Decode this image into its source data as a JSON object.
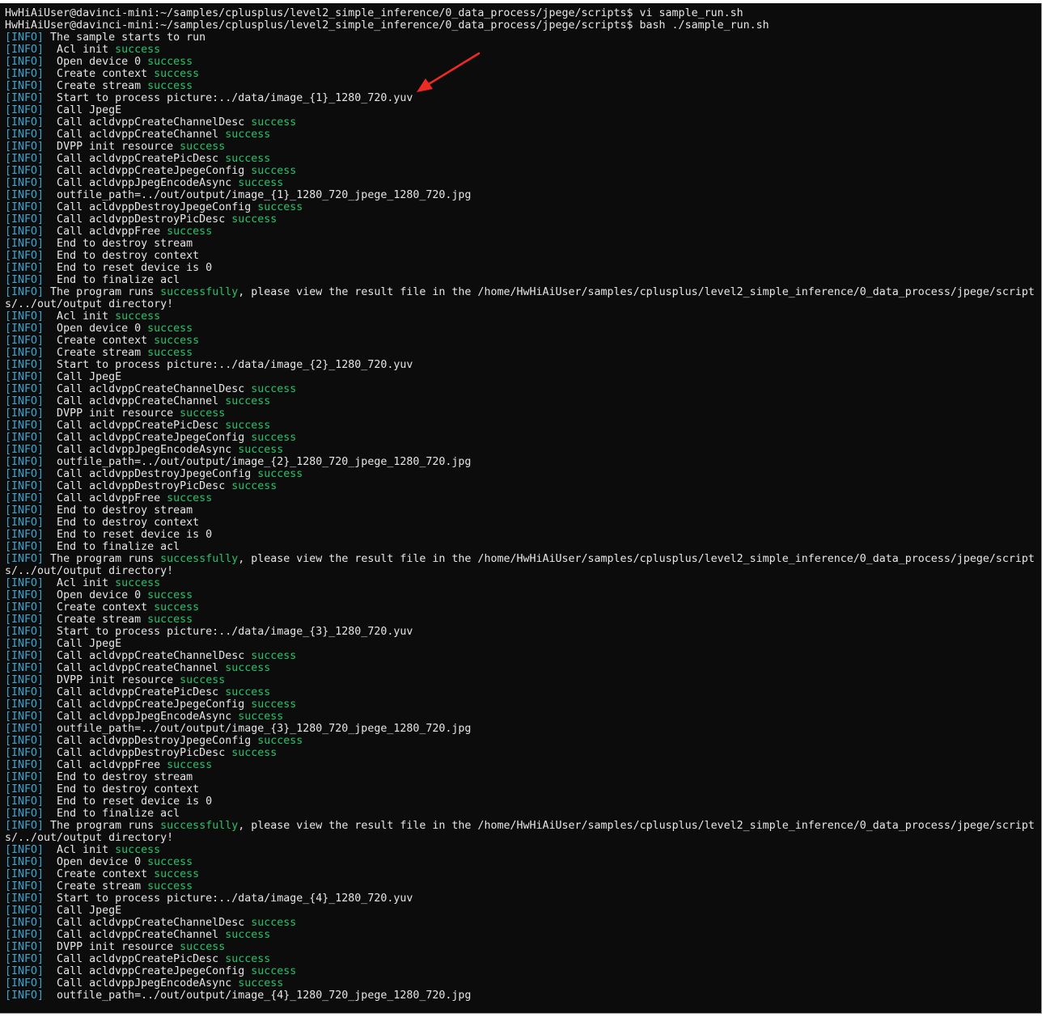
{
  "colors": {
    "background": "#0c0c0c",
    "text": "#e6e6e6",
    "info_tag": "#3aa7d0",
    "success": "#23c46b",
    "annotation_arrow": "#ee2a24"
  },
  "terminal": {
    "lines": [
      {
        "text": "HwHiAiUser@davinci-mini:~/samples/cplusplus/level2_simple_inference/0_data_process/jpege/scripts$ vi sample_run.sh"
      },
      {
        "text": "HwHiAiUser@davinci-mini:~/samples/cplusplus/level2_simple_inference/0_data_process/jpege/scripts$ bash ./sample_run.sh"
      },
      {
        "tag": "[INFO]",
        "text": " The sample starts to run"
      },
      {
        "tag": "[INFO]",
        "text": "  Acl init ",
        "ok": "success"
      },
      {
        "tag": "[INFO]",
        "text": "  Open device 0 ",
        "ok": "success"
      },
      {
        "tag": "[INFO]",
        "text": "  Create context ",
        "ok": "success"
      },
      {
        "tag": "[INFO]",
        "text": "  Create stream ",
        "ok": "success"
      },
      {
        "tag": "[INFO]",
        "text": "  Start to process picture:../data/image_{1}_1280_720.yuv"
      },
      {
        "tag": "[INFO]",
        "text": "  Call JpegE"
      },
      {
        "tag": "[INFO]",
        "text": "  Call acldvppCreateChannelDesc ",
        "ok": "success"
      },
      {
        "tag": "[INFO]",
        "text": "  Call acldvppCreateChannel ",
        "ok": "success"
      },
      {
        "tag": "[INFO]",
        "text": "  DVPP init resource ",
        "ok": "success"
      },
      {
        "tag": "[INFO]",
        "text": "  Call acldvppCreatePicDesc ",
        "ok": "success"
      },
      {
        "tag": "[INFO]",
        "text": "  Call acldvppCreateJpegeConfig ",
        "ok": "success"
      },
      {
        "tag": "[INFO]",
        "text": "  Call acldvppJpegEncodeAsync ",
        "ok": "success"
      },
      {
        "tag": "[INFO]",
        "text": "  outfile_path=../out/output/image_{1}_1280_720_jpege_1280_720.jpg"
      },
      {
        "tag": "[INFO]",
        "text": "  Call acldvppDestroyJpegeConfig ",
        "ok": "success"
      },
      {
        "tag": "[INFO]",
        "text": "  Call acldvppDestroyPicDesc ",
        "ok": "success"
      },
      {
        "tag": "[INFO]",
        "text": "  Call acldvppFree ",
        "ok": "success"
      },
      {
        "tag": "[INFO]",
        "text": "  End to destroy stream"
      },
      {
        "tag": "[INFO]",
        "text": "  End to destroy context"
      },
      {
        "tag": "[INFO]",
        "text": "  End to reset device is 0"
      },
      {
        "tag": "[INFO]",
        "text": "  End to finalize acl"
      },
      {
        "tag": "[INFO]",
        "text": " The program runs ",
        "ok": "successfully",
        "rest": ", please view the result file in the /home/HwHiAiUser/samples/cplusplus/level2_simple_inference/0_data_process/jpege/script"
      },
      {
        "text": "s/../out/output directory!"
      },
      {
        "tag": "[INFO]",
        "text": "  Acl init ",
        "ok": "success"
      },
      {
        "tag": "[INFO]",
        "text": "  Open device 0 ",
        "ok": "success"
      },
      {
        "tag": "[INFO]",
        "text": "  Create context ",
        "ok": "success"
      },
      {
        "tag": "[INFO]",
        "text": "  Create stream ",
        "ok": "success"
      },
      {
        "tag": "[INFO]",
        "text": "  Start to process picture:../data/image_{2}_1280_720.yuv"
      },
      {
        "tag": "[INFO]",
        "text": "  Call JpegE"
      },
      {
        "tag": "[INFO]",
        "text": "  Call acldvppCreateChannelDesc ",
        "ok": "success"
      },
      {
        "tag": "[INFO]",
        "text": "  Call acldvppCreateChannel ",
        "ok": "success"
      },
      {
        "tag": "[INFO]",
        "text": "  DVPP init resource ",
        "ok": "success"
      },
      {
        "tag": "[INFO]",
        "text": "  Call acldvppCreatePicDesc ",
        "ok": "success"
      },
      {
        "tag": "[INFO]",
        "text": "  Call acldvppCreateJpegeConfig ",
        "ok": "success"
      },
      {
        "tag": "[INFO]",
        "text": "  Call acldvppJpegEncodeAsync ",
        "ok": "success"
      },
      {
        "tag": "[INFO]",
        "text": "  outfile_path=../out/output/image_{2}_1280_720_jpege_1280_720.jpg"
      },
      {
        "tag": "[INFO]",
        "text": "  Call acldvppDestroyJpegeConfig ",
        "ok": "success"
      },
      {
        "tag": "[INFO]",
        "text": "  Call acldvppDestroyPicDesc ",
        "ok": "success"
      },
      {
        "tag": "[INFO]",
        "text": "  Call acldvppFree ",
        "ok": "success"
      },
      {
        "tag": "[INFO]",
        "text": "  End to destroy stream"
      },
      {
        "tag": "[INFO]",
        "text": "  End to destroy context"
      },
      {
        "tag": "[INFO]",
        "text": "  End to reset device is 0"
      },
      {
        "tag": "[INFO]",
        "text": "  End to finalize acl"
      },
      {
        "tag": "[INFO]",
        "text": " The program runs ",
        "ok": "successfully",
        "rest": ", please view the result file in the /home/HwHiAiUser/samples/cplusplus/level2_simple_inference/0_data_process/jpege/script"
      },
      {
        "text": "s/../out/output directory!"
      },
      {
        "tag": "[INFO]",
        "text": "  Acl init ",
        "ok": "success"
      },
      {
        "tag": "[INFO]",
        "text": "  Open device 0 ",
        "ok": "success"
      },
      {
        "tag": "[INFO]",
        "text": "  Create context ",
        "ok": "success"
      },
      {
        "tag": "[INFO]",
        "text": "  Create stream ",
        "ok": "success"
      },
      {
        "tag": "[INFO]",
        "text": "  Start to process picture:../data/image_{3}_1280_720.yuv"
      },
      {
        "tag": "[INFO]",
        "text": "  Call JpegE"
      },
      {
        "tag": "[INFO]",
        "text": "  Call acldvppCreateChannelDesc ",
        "ok": "success"
      },
      {
        "tag": "[INFO]",
        "text": "  Call acldvppCreateChannel ",
        "ok": "success"
      },
      {
        "tag": "[INFO]",
        "text": "  DVPP init resource ",
        "ok": "success"
      },
      {
        "tag": "[INFO]",
        "text": "  Call acldvppCreatePicDesc ",
        "ok": "success"
      },
      {
        "tag": "[INFO]",
        "text": "  Call acldvppCreateJpegeConfig ",
        "ok": "success"
      },
      {
        "tag": "[INFO]",
        "text": "  Call acldvppJpegEncodeAsync ",
        "ok": "success"
      },
      {
        "tag": "[INFO]",
        "text": "  outfile_path=../out/output/image_{3}_1280_720_jpege_1280_720.jpg"
      },
      {
        "tag": "[INFO]",
        "text": "  Call acldvppDestroyJpegeConfig ",
        "ok": "success"
      },
      {
        "tag": "[INFO]",
        "text": "  Call acldvppDestroyPicDesc ",
        "ok": "success"
      },
      {
        "tag": "[INFO]",
        "text": "  Call acldvppFree ",
        "ok": "success"
      },
      {
        "tag": "[INFO]",
        "text": "  End to destroy stream"
      },
      {
        "tag": "[INFO]",
        "text": "  End to destroy context"
      },
      {
        "tag": "[INFO]",
        "text": "  End to reset device is 0"
      },
      {
        "tag": "[INFO]",
        "text": "  End to finalize acl"
      },
      {
        "tag": "[INFO]",
        "text": " The program runs ",
        "ok": "successfully",
        "rest": ", please view the result file in the /home/HwHiAiUser/samples/cplusplus/level2_simple_inference/0_data_process/jpege/script"
      },
      {
        "text": "s/../out/output directory!"
      },
      {
        "tag": "[INFO]",
        "text": "  Acl init ",
        "ok": "success"
      },
      {
        "tag": "[INFO]",
        "text": "  Open device 0 ",
        "ok": "success"
      },
      {
        "tag": "[INFO]",
        "text": "  Create context ",
        "ok": "success"
      },
      {
        "tag": "[INFO]",
        "text": "  Create stream ",
        "ok": "success"
      },
      {
        "tag": "[INFO]",
        "text": "  Start to process picture:../data/image_{4}_1280_720.yuv"
      },
      {
        "tag": "[INFO]",
        "text": "  Call JpegE"
      },
      {
        "tag": "[INFO]",
        "text": "  Call acldvppCreateChannelDesc ",
        "ok": "success"
      },
      {
        "tag": "[INFO]",
        "text": "  Call acldvppCreateChannel ",
        "ok": "success"
      },
      {
        "tag": "[INFO]",
        "text": "  DVPP init resource ",
        "ok": "success"
      },
      {
        "tag": "[INFO]",
        "text": "  Call acldvppCreatePicDesc ",
        "ok": "success"
      },
      {
        "tag": "[INFO]",
        "text": "  Call acldvppCreateJpegeConfig ",
        "ok": "success"
      },
      {
        "tag": "[INFO]",
        "text": "  Call acldvppJpegEncodeAsync ",
        "ok": "success"
      },
      {
        "tag": "[INFO]",
        "text": "  outfile_path=../out/output/image_{4}_1280_720_jpege_1280_720.jpg"
      }
    ]
  }
}
